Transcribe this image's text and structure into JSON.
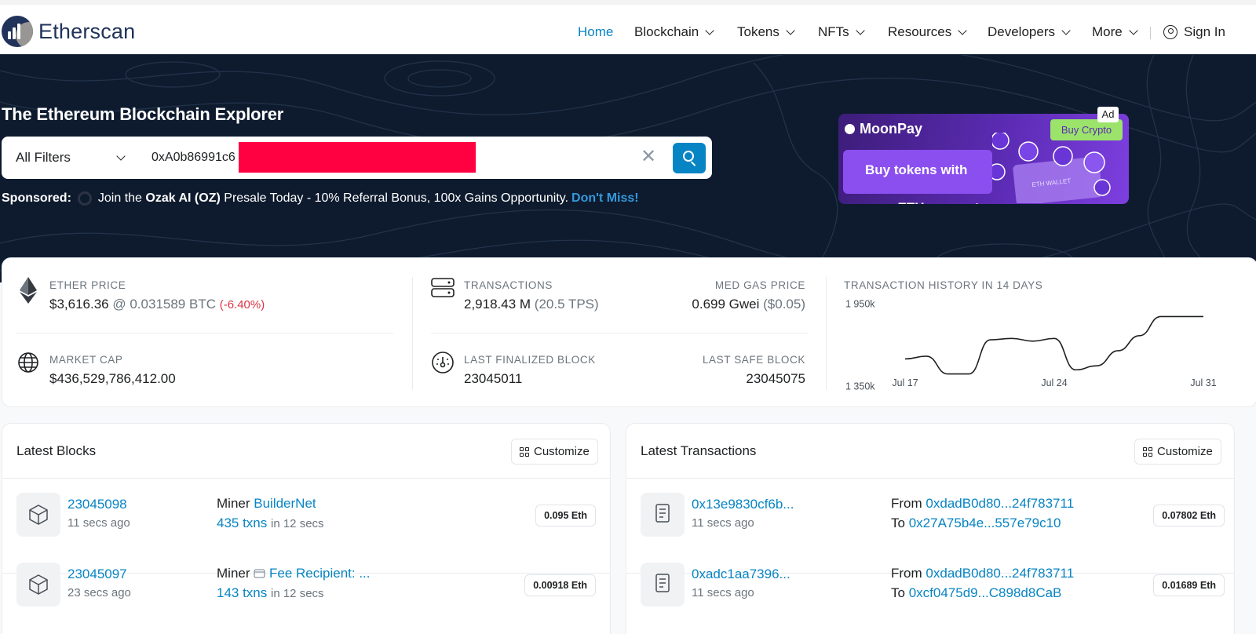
{
  "header": {
    "logo_text": "Etherscan",
    "nav": [
      {
        "label": "Home",
        "active": true
      },
      {
        "label": "Blockchain"
      },
      {
        "label": "Tokens"
      },
      {
        "label": "NFTs"
      },
      {
        "label": "Resources"
      },
      {
        "label": "Developers"
      },
      {
        "label": "More"
      }
    ],
    "sign_in": "Sign In"
  },
  "hero": {
    "title": "The Ethereum Blockchain Explorer",
    "search": {
      "filter_label": "All Filters",
      "value": "0xA0b86991c6"
    },
    "sponsored": {
      "label": "Sponsored:",
      "prefix": "Join the",
      "brand": "Ozak AI (OZ)",
      "text": "Presale Today - 10% Referral Bonus, 100x Gains Opportunity.",
      "link": "Don't Miss!"
    },
    "ad": {
      "tag": "Ad",
      "brand": "MoonPay",
      "button": "Buy Crypto",
      "headline_1": "Buy tokens with",
      "headline_2": "your ETH account",
      "art_text": "ETH WALLET"
    }
  },
  "stats": {
    "ether_price": {
      "caption": "ETHER PRICE",
      "value": "$3,616.36",
      "btc": "@ 0.031589 BTC",
      "change": "(-6.40%)"
    },
    "market_cap": {
      "caption": "MARKET CAP",
      "value": "$436,529,786,412.00"
    },
    "transactions": {
      "caption": "TRANSACTIONS",
      "value": "2,918.43 M",
      "tps": "(20.5 TPS)"
    },
    "med_gas": {
      "caption": "MED GAS PRICE",
      "value": "0.699 Gwei",
      "usd": "($0.05)"
    },
    "last_finalized": {
      "caption": "LAST FINALIZED BLOCK",
      "value": "23045011"
    },
    "last_safe": {
      "caption": "LAST SAFE BLOCK",
      "value": "23045075"
    },
    "history_caption": "TRANSACTION HISTORY IN 14 DAYS"
  },
  "chart_data": {
    "type": "line",
    "title": "TRANSACTION HISTORY IN 14 DAYS",
    "y_tick_labels": [
      "1 950k",
      "1 350k"
    ],
    "x_tick_labels": [
      "Jul 17",
      "Jul 24",
      "Jul 31"
    ],
    "y_ticks": [
      1950000,
      1350000
    ],
    "ylim": [
      1300000,
      2000000
    ],
    "x": [
      "Jul 17",
      "Jul 18",
      "Jul 19",
      "Jul 20",
      "Jul 21",
      "Jul 22",
      "Jul 23",
      "Jul 24",
      "Jul 25",
      "Jul 26",
      "Jul 27",
      "Jul 28",
      "Jul 29",
      "Jul 30",
      "Jul 31"
    ],
    "series": [
      {
        "values": [
          1550000,
          1570000,
          1440000,
          1440000,
          1690000,
          1700000,
          1680000,
          1700000,
          1470000,
          1500000,
          1610000,
          1720000,
          1860000,
          1860000,
          1860000
        ]
      }
    ],
    "grid": false,
    "legend": "none"
  },
  "blocks_panel": {
    "title": "Latest Blocks",
    "customize": "Customize",
    "rows": [
      {
        "block": "23045098",
        "age": "11 secs ago",
        "miner_label": "Miner",
        "miner": "BuilderNet",
        "txns": "435 txns",
        "time": "in 12 secs",
        "reward": "0.095 Eth"
      },
      {
        "block": "23045097",
        "age": "23 secs ago",
        "miner_label": "Miner",
        "miner": "Fee Recipient: ...",
        "txns": "143 txns",
        "time": "in 12 secs",
        "reward": "0.00918 Eth"
      }
    ]
  },
  "tx_panel": {
    "title": "Latest Transactions",
    "customize": "Customize",
    "rows": [
      {
        "hash": "0x13e9830cf6b...",
        "age": "11 secs ago",
        "from_label": "From",
        "from": "0xdadB0d80...24f783711",
        "to_label": "To",
        "to": "0x27A75b4e...557e79c10",
        "value": "0.07802 Eth"
      },
      {
        "hash": "0xadc1aa7396...",
        "age": "11 secs ago",
        "from_label": "From",
        "from": "0xdadB0d80...24f783711",
        "to_label": "To",
        "to": "0xcf0475d9...C898d8CaB",
        "value": "0.01689 Eth"
      }
    ]
  },
  "colors": {
    "accent": "#0784c3",
    "hero_bg": "#0e1b2e",
    "negative": "#dc3545"
  }
}
